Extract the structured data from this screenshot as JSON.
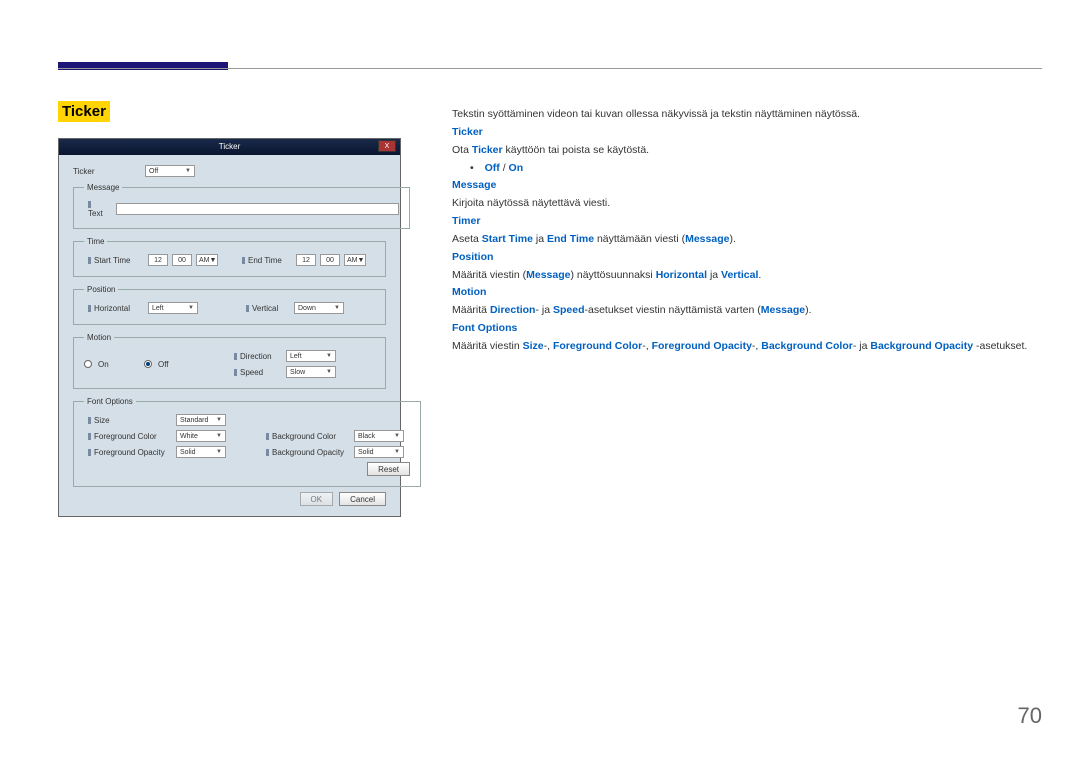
{
  "page_number": "70",
  "heading": "Ticker",
  "dialog": {
    "title": "Ticker",
    "close": "X",
    "ticker_label": "Ticker",
    "ticker_value": "Off",
    "message_legend": "Message",
    "message_sublabel": "Text",
    "time_legend": "Time",
    "start_time_label": "Start Time",
    "start_hh": "12",
    "start_mm": "00",
    "start_ampm": "AM",
    "end_time_label": "End Time",
    "end_hh": "12",
    "end_mm": "00",
    "end_ampm": "AM",
    "position_legend": "Position",
    "horizontal_label": "Horizontal",
    "horizontal_value": "Left",
    "vertical_label": "Vertical",
    "vertical_value": "Down",
    "motion_legend": "Motion",
    "motion_on_label": "On",
    "motion_off_label": "Off",
    "direction_label": "Direction",
    "direction_value": "Left",
    "speed_label": "Speed",
    "speed_value": "Slow",
    "fontoptions_legend": "Font Options",
    "size_label": "Size",
    "size_value": "Standard",
    "fgcolor_label": "Foreground Color",
    "fgcolor_value": "White",
    "bgcolor_label": "Background Color",
    "bgcolor_value": "Black",
    "fgopacity_label": "Foreground Opacity",
    "fgopacity_value": "Solid",
    "bgopacity_label": "Background Opacity",
    "bgopacity_value": "Solid",
    "reset_label": "Reset",
    "ok_label": "OK",
    "cancel_label": "Cancel"
  },
  "body": {
    "intro": "Tekstin syöttäminen videon tai kuvan ollessa näkyvissä ja tekstin näyttäminen näytössä.",
    "ticker_h": "Ticker",
    "ticker_pre": "Ota ",
    "ticker_b": "Ticker",
    "ticker_post": " käyttöön tai poista se käytöstä.",
    "offon_pre": "Off",
    "offon_sep": " / ",
    "offon_post": "On",
    "message_h": "Message",
    "message_t": "Kirjoita näytössä näytettävä viesti.",
    "timer_h": "Timer",
    "timer_pre": "Aseta ",
    "timer_b1": "Start Time",
    "timer_mid": " ja ",
    "timer_b2": "End Time",
    "timer_post1": " näyttämään viesti (",
    "timer_msg": "Message",
    "timer_post2": ").",
    "position_h": "Position",
    "position_pre": "Määritä viestin (",
    "position_msg": "Message",
    "position_mid": ") näyttösuunnaksi ",
    "position_b1": "Horizontal",
    "position_sep": " ja ",
    "position_b2": "Vertical",
    "position_post": ".",
    "motion_h": "Motion",
    "motion_pre": "Määritä ",
    "motion_b1": "Direction",
    "motion_mid1": "- ja ",
    "motion_b2": "Speed",
    "motion_mid2": "-asetukset viestin näyttämistä varten (",
    "motion_msg": "Message",
    "motion_post": ").",
    "fontoptions_h": "Font Options",
    "fo_pre": "Määritä viestin ",
    "fo_b1": "Size",
    "fo_s1": "-, ",
    "fo_b2": "Foreground Color",
    "fo_s2": "-, ",
    "fo_b3": "Foreground Opacity",
    "fo_s3": "-, ",
    "fo_b4": "Background Color",
    "fo_s4": "- ja ",
    "fo_b5": "Background Opacity",
    "fo_post": " -asetukset."
  }
}
